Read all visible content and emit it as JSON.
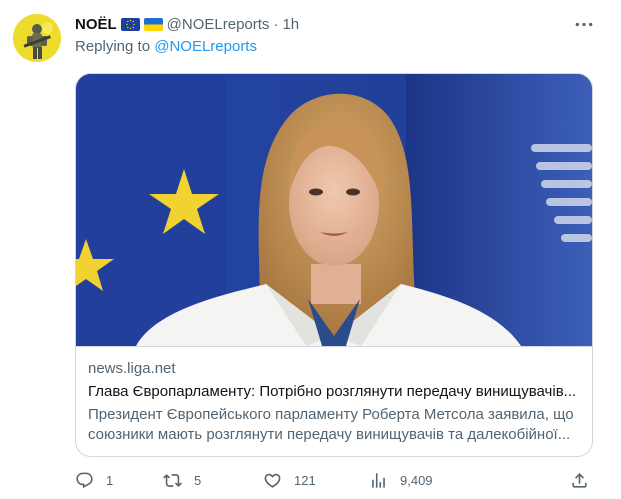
{
  "tweet": {
    "author_name": "NOËL",
    "author_handle": "@NOELreports",
    "separator": "·",
    "time": "1h",
    "flags": [
      "eu-flag-icon",
      "ukraine-flag-icon"
    ],
    "replying_prefix": "Replying to ",
    "replying_to": "@NOELreports"
  },
  "card": {
    "domain": "news.liga.net",
    "title": "Глава Європарламенту: Потрібно розглянути передачу винищувачів...",
    "description": "Президент Європейського парламенту Роберта Метсола заявила, що союзники мають розглянути передачу винищувачів та далекобійної..."
  },
  "actions": {
    "replies": "1",
    "retweets": "5",
    "likes": "121",
    "views": "9,409"
  },
  "icons": {
    "more": "more-dots-icon",
    "reply": "reply-icon",
    "retweet": "retweet-icon",
    "like": "heart-icon",
    "views": "views-icon",
    "share": "share-icon"
  },
  "colors": {
    "link": "#1d9bf0",
    "secondary_text": "#536471",
    "border": "#cfd9de"
  }
}
